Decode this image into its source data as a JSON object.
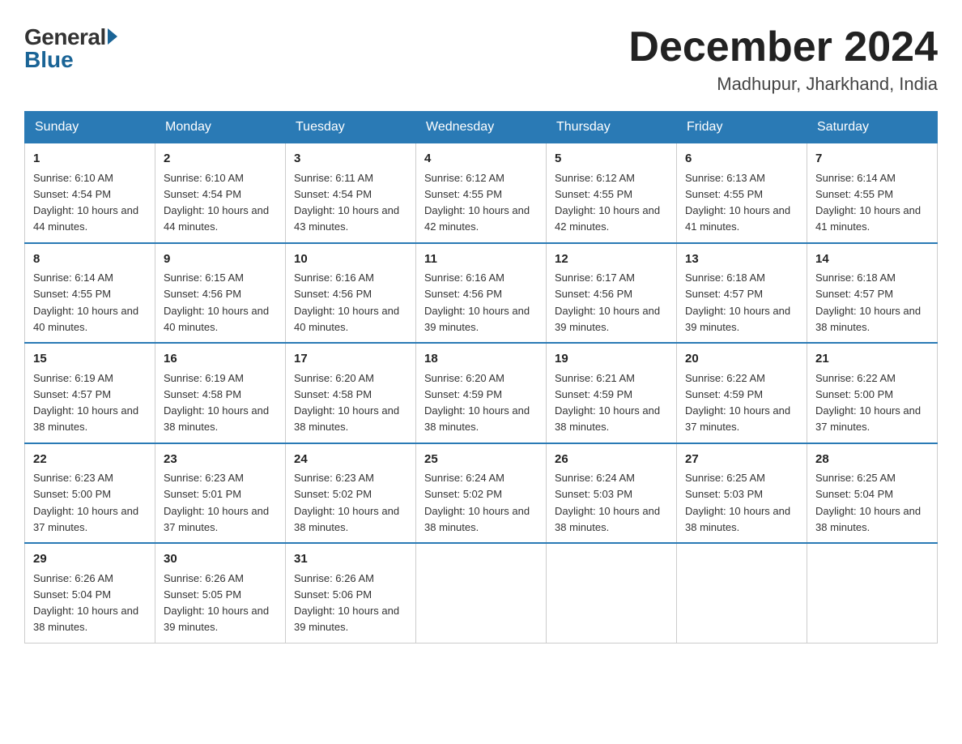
{
  "header": {
    "logo_general": "General",
    "logo_blue": "Blue",
    "month_year": "December 2024",
    "location": "Madhupur, Jharkhand, India"
  },
  "days_of_week": [
    "Sunday",
    "Monday",
    "Tuesday",
    "Wednesday",
    "Thursday",
    "Friday",
    "Saturday"
  ],
  "weeks": [
    [
      {
        "day": "1",
        "sunrise": "6:10 AM",
        "sunset": "4:54 PM",
        "daylight": "10 hours and 44 minutes."
      },
      {
        "day": "2",
        "sunrise": "6:10 AM",
        "sunset": "4:54 PM",
        "daylight": "10 hours and 44 minutes."
      },
      {
        "day": "3",
        "sunrise": "6:11 AM",
        "sunset": "4:54 PM",
        "daylight": "10 hours and 43 minutes."
      },
      {
        "day": "4",
        "sunrise": "6:12 AM",
        "sunset": "4:55 PM",
        "daylight": "10 hours and 42 minutes."
      },
      {
        "day": "5",
        "sunrise": "6:12 AM",
        "sunset": "4:55 PM",
        "daylight": "10 hours and 42 minutes."
      },
      {
        "day": "6",
        "sunrise": "6:13 AM",
        "sunset": "4:55 PM",
        "daylight": "10 hours and 41 minutes."
      },
      {
        "day": "7",
        "sunrise": "6:14 AM",
        "sunset": "4:55 PM",
        "daylight": "10 hours and 41 minutes."
      }
    ],
    [
      {
        "day": "8",
        "sunrise": "6:14 AM",
        "sunset": "4:55 PM",
        "daylight": "10 hours and 40 minutes."
      },
      {
        "day": "9",
        "sunrise": "6:15 AM",
        "sunset": "4:56 PM",
        "daylight": "10 hours and 40 minutes."
      },
      {
        "day": "10",
        "sunrise": "6:16 AM",
        "sunset": "4:56 PM",
        "daylight": "10 hours and 40 minutes."
      },
      {
        "day": "11",
        "sunrise": "6:16 AM",
        "sunset": "4:56 PM",
        "daylight": "10 hours and 39 minutes."
      },
      {
        "day": "12",
        "sunrise": "6:17 AM",
        "sunset": "4:56 PM",
        "daylight": "10 hours and 39 minutes."
      },
      {
        "day": "13",
        "sunrise": "6:18 AM",
        "sunset": "4:57 PM",
        "daylight": "10 hours and 39 minutes."
      },
      {
        "day": "14",
        "sunrise": "6:18 AM",
        "sunset": "4:57 PM",
        "daylight": "10 hours and 38 minutes."
      }
    ],
    [
      {
        "day": "15",
        "sunrise": "6:19 AM",
        "sunset": "4:57 PM",
        "daylight": "10 hours and 38 minutes."
      },
      {
        "day": "16",
        "sunrise": "6:19 AM",
        "sunset": "4:58 PM",
        "daylight": "10 hours and 38 minutes."
      },
      {
        "day": "17",
        "sunrise": "6:20 AM",
        "sunset": "4:58 PM",
        "daylight": "10 hours and 38 minutes."
      },
      {
        "day": "18",
        "sunrise": "6:20 AM",
        "sunset": "4:59 PM",
        "daylight": "10 hours and 38 minutes."
      },
      {
        "day": "19",
        "sunrise": "6:21 AM",
        "sunset": "4:59 PM",
        "daylight": "10 hours and 38 minutes."
      },
      {
        "day": "20",
        "sunrise": "6:22 AM",
        "sunset": "4:59 PM",
        "daylight": "10 hours and 37 minutes."
      },
      {
        "day": "21",
        "sunrise": "6:22 AM",
        "sunset": "5:00 PM",
        "daylight": "10 hours and 37 minutes."
      }
    ],
    [
      {
        "day": "22",
        "sunrise": "6:23 AM",
        "sunset": "5:00 PM",
        "daylight": "10 hours and 37 minutes."
      },
      {
        "day": "23",
        "sunrise": "6:23 AM",
        "sunset": "5:01 PM",
        "daylight": "10 hours and 37 minutes."
      },
      {
        "day": "24",
        "sunrise": "6:23 AM",
        "sunset": "5:02 PM",
        "daylight": "10 hours and 38 minutes."
      },
      {
        "day": "25",
        "sunrise": "6:24 AM",
        "sunset": "5:02 PM",
        "daylight": "10 hours and 38 minutes."
      },
      {
        "day": "26",
        "sunrise": "6:24 AM",
        "sunset": "5:03 PM",
        "daylight": "10 hours and 38 minutes."
      },
      {
        "day": "27",
        "sunrise": "6:25 AM",
        "sunset": "5:03 PM",
        "daylight": "10 hours and 38 minutes."
      },
      {
        "day": "28",
        "sunrise": "6:25 AM",
        "sunset": "5:04 PM",
        "daylight": "10 hours and 38 minutes."
      }
    ],
    [
      {
        "day": "29",
        "sunrise": "6:26 AM",
        "sunset": "5:04 PM",
        "daylight": "10 hours and 38 minutes."
      },
      {
        "day": "30",
        "sunrise": "6:26 AM",
        "sunset": "5:05 PM",
        "daylight": "10 hours and 39 minutes."
      },
      {
        "day": "31",
        "sunrise": "6:26 AM",
        "sunset": "5:06 PM",
        "daylight": "10 hours and 39 minutes."
      },
      null,
      null,
      null,
      null
    ]
  ],
  "labels": {
    "sunrise": "Sunrise: ",
    "sunset": "Sunset: ",
    "daylight": "Daylight: "
  }
}
